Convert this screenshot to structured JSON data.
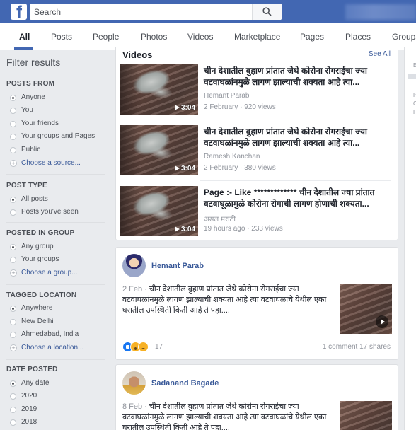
{
  "header": {
    "logo_letter": "f",
    "search": {
      "placeholder": "Search",
      "value": ""
    }
  },
  "tabs": [
    "All",
    "Posts",
    "People",
    "Photos",
    "Videos",
    "Marketplace",
    "Pages",
    "Places",
    "Groups"
  ],
  "active_tab": "All",
  "filters": {
    "title": "Filter results",
    "sections": [
      {
        "heading": "POSTS FROM",
        "options": [
          "Anyone",
          "You",
          "Your friends",
          "Your groups and Pages",
          "Public"
        ],
        "selected": "Anyone",
        "link": "Choose a source..."
      },
      {
        "heading": "POST TYPE",
        "options": [
          "All posts",
          "Posts you've seen"
        ],
        "selected": "All posts"
      },
      {
        "heading": "POSTED IN GROUP",
        "options": [
          "Any group",
          "Your groups"
        ],
        "selected": "Any group",
        "link": "Choose a group..."
      },
      {
        "heading": "TAGGED LOCATION",
        "options": [
          "Anywhere",
          "New Delhi",
          "Ahmedabad, India"
        ],
        "selected": "Anywhere",
        "link": "Choose a location..."
      },
      {
        "heading": "DATE POSTED",
        "options": [
          "Any date",
          "2020",
          "2019",
          "2018"
        ],
        "selected": "Any date"
      }
    ]
  },
  "videos": {
    "heading": "Videos",
    "see_all": "See All",
    "items": [
      {
        "title": "चीन देशातील वुहाण प्रांतात जेथे कोरोना रोगराईचा ज्या वटवाघळांनमुळे लागण झाल्याची शक्यता आहे त्या...",
        "source": "Hemant Parab",
        "meta": "2 February · 920 views",
        "duration": "3:04"
      },
      {
        "title": "चीन देशातील वुहाण प्रांतात जेथे कोरोना रोगराईचा ज्या वटवाघळांनमुळे लागण झाल्याची शक्यता आहे त्या...",
        "source": "Ramesh Kanchan",
        "meta": "2 February · 380 views",
        "duration": "3:04"
      },
      {
        "title": "Page :- Like ************* चीन देशातील ज्या प्रांतात वटवाघूळामुळे कोरोना रोगाची लागण होणाची शक्यता...",
        "source": "असल मराठी",
        "meta": "19 hours ago · 233 views",
        "duration": "3:04"
      }
    ]
  },
  "posts": [
    {
      "author": "Hemant Parab",
      "date": "2 Feb · ",
      "text": "चीन देशातील वुहाण प्रांतात जेथे कोरोना रोगराईचा ज्या वटवाघळांनमुळे लागण झाल्याची शक्यता आहे त्या वटवाघळांचे येथील एका घरातील उपस्थिती किती आहे ते पहा....",
      "reactions": "17",
      "stats": "1 comment  17 shares"
    },
    {
      "author": "Sadanand Bagade",
      "date": "8 Feb · ",
      "text": "चीन देशातील वुहाण प्रांतात जेथे कोरोना रोगराईचा ज्या वटवाघळांनमुळे लागण झाल्याची शक्यता आहे त्या वटवाघळांचे येथील एका घरातील उपस्थिती किती आहे ते पहा....",
      "reactions": "",
      "stats": ""
    }
  ],
  "right_col": {
    "letters": [
      "E",
      "P",
      "C",
      "F"
    ]
  },
  "colors": {
    "brand": "#4267b2",
    "link": "#385898",
    "muted": "#90949c"
  }
}
